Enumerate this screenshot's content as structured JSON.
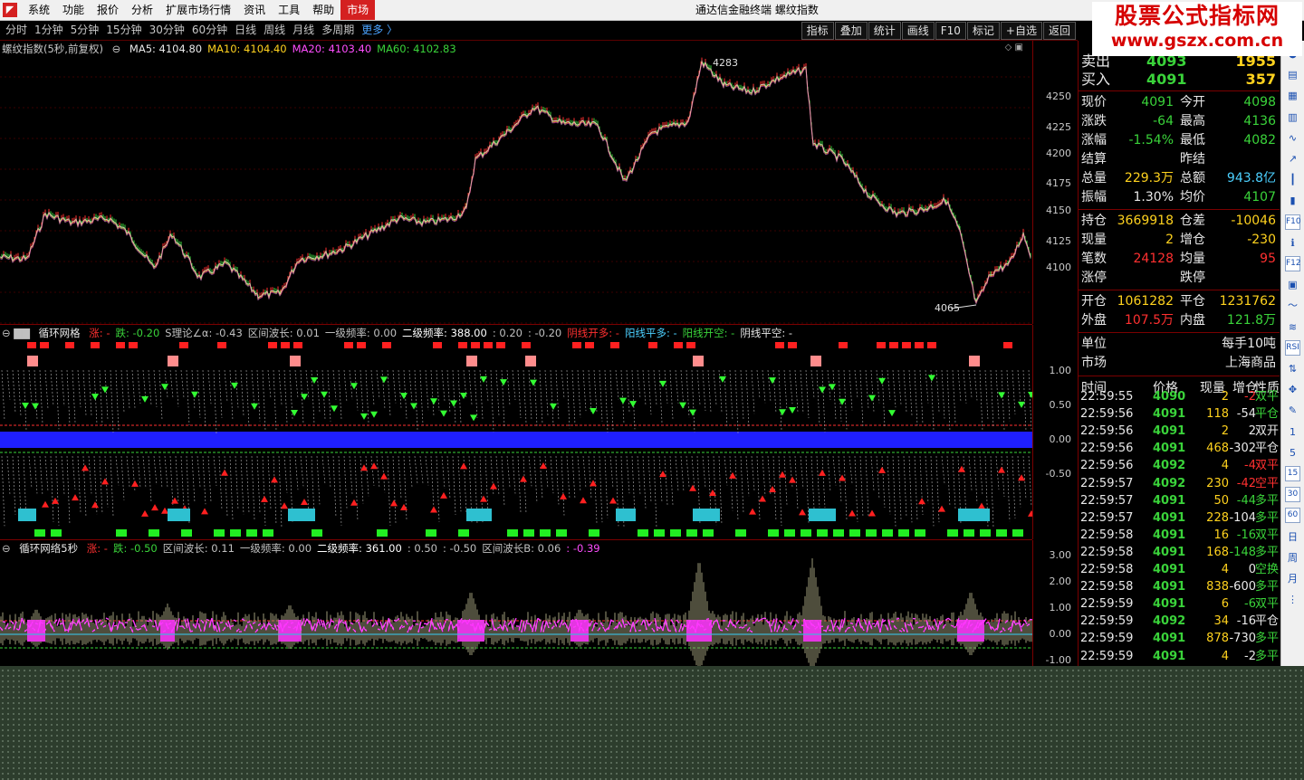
{
  "menubar": {
    "items": [
      "系统",
      "功能",
      "报价",
      "分析",
      "扩展市场行情",
      "资讯",
      "工具",
      "帮助",
      "市场"
    ],
    "active": "市场",
    "window_title": "通达信金融终端  螺纹指数"
  },
  "brand": {
    "line1": "股票公式指标网",
    "line2": "www.gszx.com.cn"
  },
  "periods": [
    "分时",
    "1分钟",
    "5分钟",
    "15分钟",
    "30分钟",
    "60分钟",
    "日线",
    "周线",
    "月线",
    "多周期",
    "更多 〉"
  ],
  "tools": [
    "指标",
    "叠加",
    "统计",
    "画线",
    "F10",
    "标记",
    "+自选",
    "返回"
  ],
  "main_chart": {
    "title": "螺纹指数(5秒,前复权)",
    "ma": [
      {
        "label": "MA5: 4104.80",
        "color": "#e8e8e8"
      },
      {
        "label": "MA10: 4104.40",
        "color": "#ffd21e"
      },
      {
        "label": "MA20: 4103.40",
        "color": "#ff4dff"
      },
      {
        "label": "MA60: 4102.83",
        "color": "#3ad33a"
      }
    ],
    "high_label": "4283",
    "low_label": "4065",
    "yticks": [
      "4250",
      "4225",
      "4200",
      "4175",
      "4150",
      "4125",
      "4100"
    ],
    "colors": {
      "up": "#ff3030",
      "down": "#3ad33a",
      "ma5": "#e8e8e8",
      "ma10": "#ffd21e",
      "ma20": "#ff4dff"
    }
  },
  "ind1": {
    "name": "循环网格",
    "params": [
      {
        "text": "涨: -",
        "color": "#ff3030"
      },
      {
        "text": "跌: -0.20",
        "color": "#3ad33a"
      },
      {
        "text": "S理论∠α: -0.43",
        "color": "#c0c0c0"
      },
      {
        "text": "区间波长: 0.01",
        "color": "#c0c0c0"
      },
      {
        "text": "一级频率: 0.00",
        "color": "#c0c0c0"
      },
      {
        "text": "二级频率: 388.00",
        "color": "#ffffff"
      },
      {
        "text": ": 0.20",
        "color": "#c0c0c0"
      },
      {
        "text": ": -0.20",
        "color": "#c0c0c0"
      },
      {
        "text": "阴线开多: -",
        "color": "#ff3030"
      },
      {
        "text": "阳线平多: -",
        "color": "#4cd0ff"
      },
      {
        "text": "阳线开空: -",
        "color": "#3ad33a"
      },
      {
        "text": "阴线平空: -",
        "color": "#e8e8e8"
      }
    ],
    "yticks": [
      "1.00",
      "0.50",
      "0.00",
      "-0.50"
    ]
  },
  "ind2": {
    "name": "循环网络5秒",
    "params": [
      {
        "text": "涨: -",
        "color": "#ff3030"
      },
      {
        "text": "跌: -0.50",
        "color": "#3ad33a"
      },
      {
        "text": "区间波长: 0.11",
        "color": "#c0c0c0"
      },
      {
        "text": "一级频率: 0.00",
        "color": "#c0c0c0"
      },
      {
        "text": "二级频率: 361.00",
        "color": "#ffffff"
      },
      {
        "text": ": 0.50",
        "color": "#c0c0c0"
      },
      {
        "text": ": -0.50",
        "color": "#c0c0c0"
      },
      {
        "text": "区间波长B: 0.06",
        "color": "#c0c0c0"
      },
      {
        "text": ": -0.39",
        "color": "#ff4dff"
      }
    ],
    "yticks": [
      "3.00",
      "2.00",
      "1.00",
      "0.00",
      "-1.00"
    ]
  },
  "quote": {
    "sell": {
      "label": "卖出",
      "price": "4093",
      "vol": "1955"
    },
    "buy": {
      "label": "买入",
      "price": "4091",
      "vol": "357"
    },
    "rows": [
      {
        "l1": "现价",
        "v1": "4091",
        "c1": "grn",
        "l2": "今开",
        "v2": "4098",
        "c2": "grn"
      },
      {
        "l1": "涨跌",
        "v1": "-64",
        "c1": "grn",
        "l2": "最高",
        "v2": "4136",
        "c2": "grn"
      },
      {
        "l1": "涨幅",
        "v1": "-1.54%",
        "c1": "grn",
        "l2": "最低",
        "v2": "4082",
        "c2": "grn"
      },
      {
        "l1": "结算",
        "v1": "",
        "c1": "wht",
        "l2": "昨结",
        "v2": "",
        "c2": "wht"
      },
      {
        "l1": "总量",
        "v1": "229.3万",
        "c1": "yel",
        "l2": "总额",
        "v2": "943.8亿",
        "c2": "cyn"
      },
      {
        "l1": "振幅",
        "v1": "1.30%",
        "c1": "wht",
        "l2": "均价",
        "v2": "4107",
        "c2": "grn"
      }
    ],
    "rows2": [
      {
        "l1": "持仓",
        "v1": "3669918",
        "c1": "yel",
        "l2": "仓差",
        "v2": "-10046",
        "c2": "yel"
      },
      {
        "l1": "现量",
        "v1": "2",
        "c1": "yel",
        "l2": "增仓",
        "v2": "-230",
        "c2": "yel"
      },
      {
        "l1": "笔数",
        "v1": "24128",
        "c1": "red",
        "l2": "均量",
        "v2": "95",
        "c2": "red"
      },
      {
        "l1": "涨停",
        "v1": "",
        "c1": "wht",
        "l2": "跌停",
        "v2": "",
        "c2": "wht"
      }
    ],
    "rows3": [
      {
        "l1": "开仓",
        "v1": "1061282",
        "c1": "yel",
        "l2": "平仓",
        "v2": "1231762",
        "c2": "yel"
      },
      {
        "l1": "外盘",
        "v1": "107.5万",
        "c1": "red",
        "l2": "内盘",
        "v2": "121.8万",
        "c2": "grn"
      }
    ],
    "unit_label": "单位",
    "unit_value": "每手10吨",
    "market_label": "市场",
    "market_value": "上海商品",
    "tick_header": [
      "时间",
      "价格",
      "现量",
      "增仓",
      "性质"
    ],
    "ticks": [
      {
        "t": "22:59:55",
        "p": "4090",
        "v": "2",
        "o": "-2",
        "n": "双平",
        "pc": "grn",
        "oc": "red",
        "nc": "grn"
      },
      {
        "t": "22:59:56",
        "p": "4091",
        "v": "118",
        "o": "-54",
        "n": "平仓",
        "pc": "grn",
        "oc": "wht",
        "nc": "grn"
      },
      {
        "t": "22:59:56",
        "p": "4091",
        "v": "2",
        "o": "2",
        "n": "双开",
        "pc": "grn",
        "oc": "wht",
        "nc": "wht"
      },
      {
        "t": "22:59:56",
        "p": "4091",
        "v": "468",
        "o": "-302",
        "n": "平仓",
        "pc": "grn",
        "oc": "wht",
        "nc": "wht"
      },
      {
        "t": "22:59:56",
        "p": "4092",
        "v": "4",
        "o": "-4",
        "n": "双平",
        "pc": "grn",
        "oc": "red",
        "nc": "red"
      },
      {
        "t": "22:59:57",
        "p": "4092",
        "v": "230",
        "o": "-42",
        "n": "空平",
        "pc": "grn",
        "oc": "red",
        "nc": "red"
      },
      {
        "t": "22:59:57",
        "p": "4091",
        "v": "50",
        "o": "-44",
        "n": "多平",
        "pc": "grn",
        "oc": "grn",
        "nc": "grn"
      },
      {
        "t": "22:59:57",
        "p": "4091",
        "v": "228",
        "o": "-104",
        "n": "多平",
        "pc": "grn",
        "oc": "wht",
        "nc": "grn"
      },
      {
        "t": "22:59:58",
        "p": "4091",
        "v": "16",
        "o": "-16",
        "n": "双平",
        "pc": "grn",
        "oc": "grn",
        "nc": "grn"
      },
      {
        "t": "22:59:58",
        "p": "4091",
        "v": "168",
        "o": "-148",
        "n": "多平",
        "pc": "grn",
        "oc": "grn",
        "nc": "grn"
      },
      {
        "t": "22:59:58",
        "p": "4091",
        "v": "4",
        "o": "0",
        "n": "空换",
        "pc": "grn",
        "oc": "wht",
        "nc": "grn"
      },
      {
        "t": "22:59:58",
        "p": "4091",
        "v": "838",
        "o": "-600",
        "n": "多平",
        "pc": "grn",
        "oc": "wht",
        "nc": "grn"
      },
      {
        "t": "22:59:59",
        "p": "4091",
        "v": "6",
        "o": "-6",
        "n": "双平",
        "pc": "grn",
        "oc": "grn",
        "nc": "grn"
      },
      {
        "t": "22:59:59",
        "p": "4092",
        "v": "34",
        "o": "-16",
        "n": "平仓",
        "pc": "grn",
        "oc": "wht",
        "nc": "wht"
      },
      {
        "t": "22:59:59",
        "p": "4091",
        "v": "878",
        "o": "-730",
        "n": "多平",
        "pc": "grn",
        "oc": "wht",
        "nc": "grn"
      },
      {
        "t": "22:59:59",
        "p": "4091",
        "v": "4",
        "o": "-2",
        "n": "多平",
        "pc": "grn",
        "oc": "wht",
        "nc": "grn"
      }
    ]
  },
  "iconbar": [
    {
      "name": "dot-icon",
      "glyph": "●"
    },
    {
      "name": "list-icon",
      "glyph": "▤"
    },
    {
      "name": "grid-icon",
      "glyph": "▦"
    },
    {
      "name": "table-icon",
      "glyph": "▥"
    },
    {
      "name": "line-chart-icon",
      "glyph": "∿"
    },
    {
      "name": "trend-icon",
      "glyph": "↗"
    },
    {
      "name": "candle-icon",
      "glyph": "┃"
    },
    {
      "name": "bar-icon",
      "glyph": "▮"
    },
    {
      "name": "f10-icon",
      "glyph": "F10"
    },
    {
      "name": "info-icon",
      "glyph": "ℹ"
    },
    {
      "name": "f12-icon",
      "glyph": "F12"
    },
    {
      "name": "tick-icon",
      "glyph": "▣"
    },
    {
      "name": "wave-icon",
      "glyph": "〜"
    },
    {
      "name": "macd-icon",
      "glyph": "≋"
    },
    {
      "name": "rsi-icon",
      "glyph": "RSI"
    },
    {
      "name": "sort-icon",
      "glyph": "⇅"
    },
    {
      "name": "move-icon",
      "glyph": "✥"
    },
    {
      "name": "pen-icon",
      "glyph": "✎"
    },
    {
      "name": "period-1",
      "glyph": "1"
    },
    {
      "name": "period-5",
      "glyph": "5"
    },
    {
      "name": "period-15",
      "glyph": "15"
    },
    {
      "name": "period-30",
      "glyph": "30"
    },
    {
      "name": "period-60",
      "glyph": "60"
    },
    {
      "name": "period-day",
      "glyph": "日"
    },
    {
      "name": "period-week",
      "glyph": "周"
    },
    {
      "name": "period-month",
      "glyph": "月"
    },
    {
      "name": "more-icon",
      "glyph": "⋮"
    }
  ]
}
